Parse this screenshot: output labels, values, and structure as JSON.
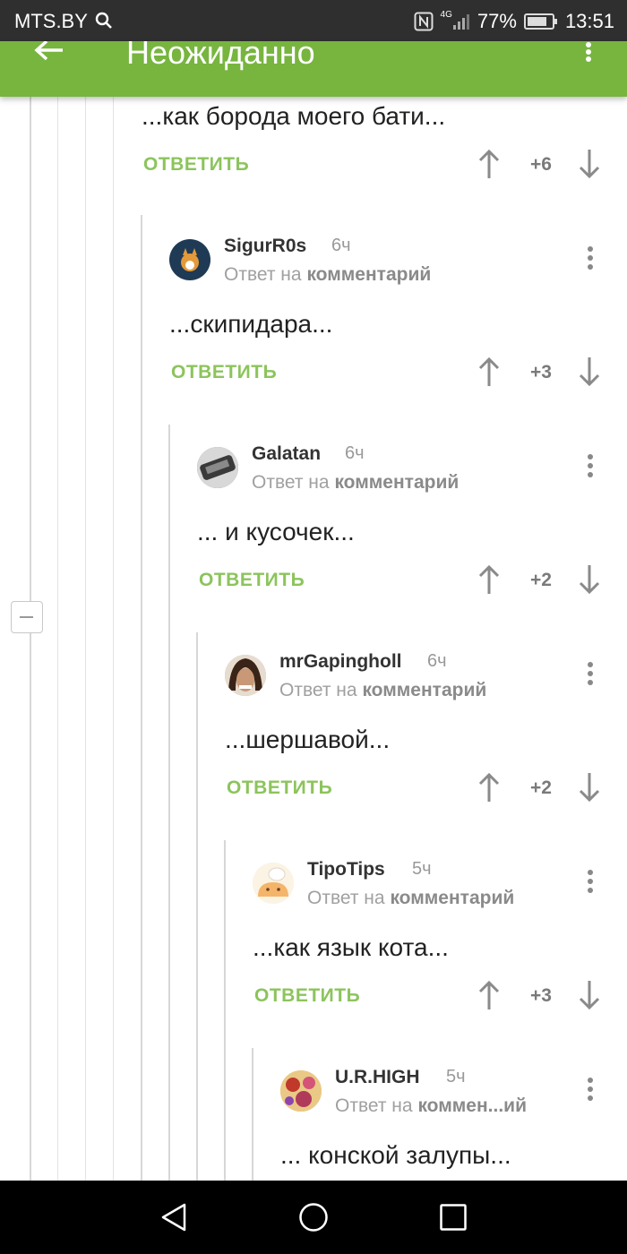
{
  "status_bar": {
    "carrier": "MTS.BY",
    "network": "4G",
    "battery": "77%",
    "time": "13:51"
  },
  "app_bar": {
    "title": "Неожиданно",
    "back_icon": "arrow-left-icon",
    "menu_icon": "more-vertical-icon"
  },
  "labels": {
    "reply": "ОТВЕТИТЬ",
    "reply_to_prefix": "Ответ на",
    "reply_to_link": "комментарий"
  },
  "top_comment": {
    "text": "...как борода моего бати...",
    "score": "+6"
  },
  "comments": [
    {
      "username": "SigurR0s",
      "time": "6ч",
      "reply_link": "комментарий",
      "text": "...скипидара...",
      "score": "+3"
    },
    {
      "username": "Galatan",
      "time": "6ч",
      "reply_link": "комментарий",
      "text": "... и кусочек...",
      "score": "+2"
    },
    {
      "username": "mrGapingholl",
      "time": "6ч",
      "reply_link": "комментарий",
      "text": "...шершавой...",
      "score": "+2"
    },
    {
      "username": "TipoTips",
      "time": "5ч",
      "reply_link": "комментарий",
      "text": "...как язык кота...",
      "score": "+3"
    },
    {
      "username": "U.R.HIGH",
      "time": "5ч",
      "reply_link": "коммен...ий",
      "text": "... конской залупы...",
      "score": ""
    }
  ],
  "colors": {
    "app_bar": "#77b53f",
    "reply_button": "#8cc45c",
    "status_bar": "#2f2f2f"
  },
  "nav_bar": {
    "back": "triangle-back-icon",
    "home": "circle-home-icon",
    "recents": "square-recents-icon"
  }
}
